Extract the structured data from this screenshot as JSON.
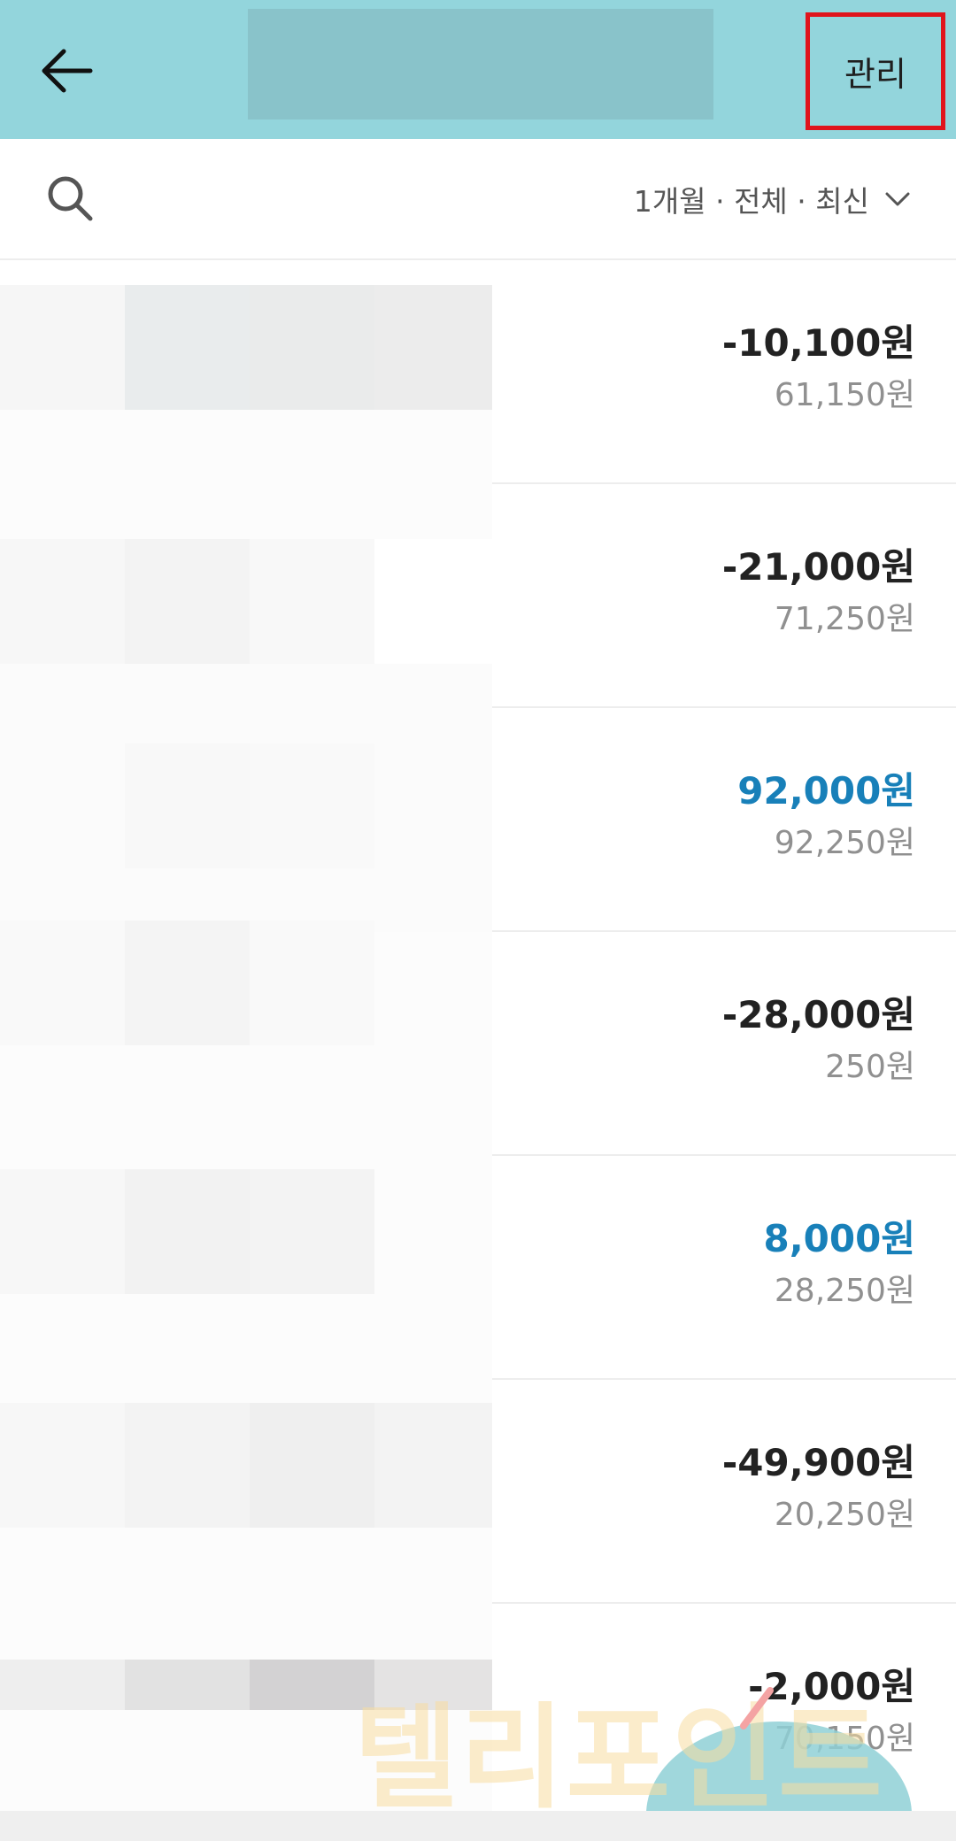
{
  "header": {
    "back_icon": "arrow-left-icon",
    "manage_label": "관리",
    "colors": {
      "header_bg": "#93d5dc",
      "highlight_border": "#e0141c"
    }
  },
  "filter": {
    "search_icon": "search-icon",
    "label": "1개월 · 전체 · 최신",
    "chevron_icon": "chevron-down-icon"
  },
  "transactions": [
    {
      "amount": "-10,100원",
      "balance": "61,150원",
      "type": "withdrawal"
    },
    {
      "amount": "-21,000원",
      "balance": "71,250원",
      "type": "withdrawal"
    },
    {
      "amount": "92,000원",
      "balance": "92,250원",
      "type": "deposit"
    },
    {
      "amount": "-28,000원",
      "balance": "250원",
      "type": "withdrawal"
    },
    {
      "amount": "8,000원",
      "balance": "28,250원",
      "type": "deposit"
    },
    {
      "amount": "-49,900원",
      "balance": "20,250원",
      "type": "withdrawal"
    },
    {
      "amount": "-2,000원",
      "balance": "70,150원",
      "type": "withdrawal"
    }
  ],
  "colors": {
    "deposit": "#1880b9",
    "withdrawal": "#222222",
    "balance": "#909090"
  },
  "watermark": {
    "text": "텔리포인트"
  }
}
